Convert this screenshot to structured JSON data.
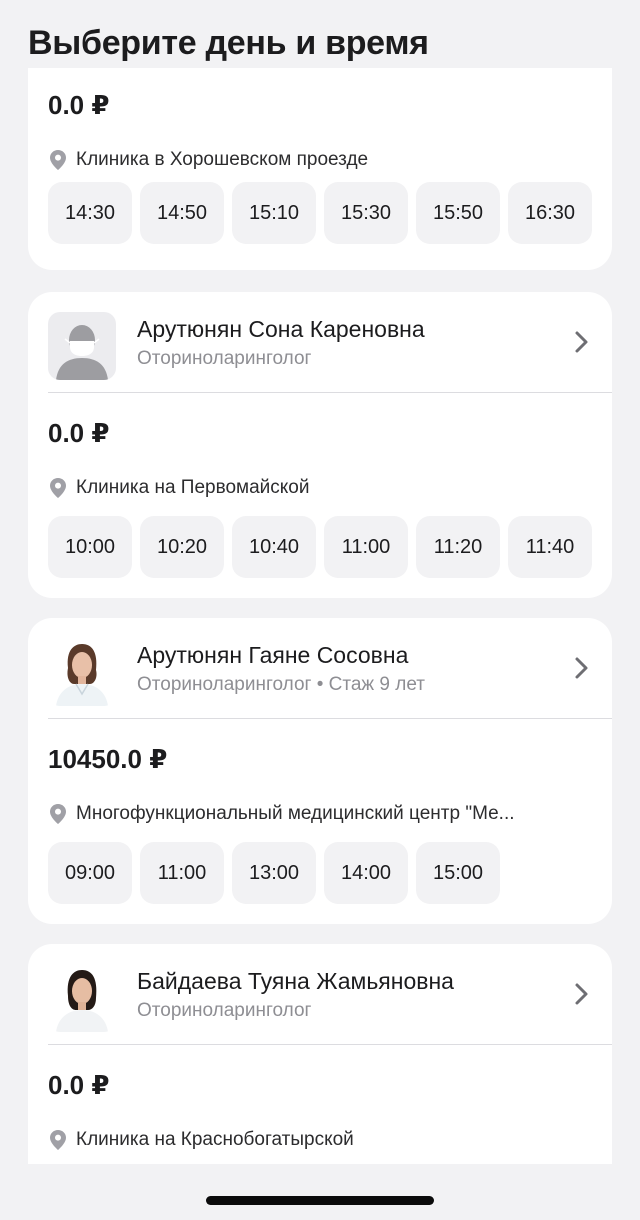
{
  "header": {
    "title": "Выберите день и время"
  },
  "colors": {
    "background": "#f2f2f4",
    "card": "#ffffff",
    "slot": "#f2f2f4",
    "muted_text": "#8e8e93"
  },
  "cards": [
    {
      "price": "0.0 ₽",
      "clinic": "Клиника в Хорошевском проезде",
      "slots": [
        "14:30",
        "14:50",
        "15:10",
        "15:30",
        "15:50",
        "16:30"
      ]
    },
    {
      "doctor_name": "Арутюнян Сона Кареновна",
      "specialty": "Оториноларинголог",
      "avatar": "placeholder-avatar-icon",
      "price": "0.0 ₽",
      "clinic": "Клиника на Первомайской",
      "slots": [
        "10:00",
        "10:20",
        "10:40",
        "11:00",
        "11:20",
        "11:40"
      ]
    },
    {
      "doctor_name": "Арутюнян Гаяне Сосовна",
      "specialty": "Оториноларинголог • Стаж 9 лет",
      "avatar": "doctor-photo",
      "price": "10450.0 ₽",
      "clinic": "Многофункциональный медицинский центр \"Ме...",
      "slots": [
        "09:00",
        "11:00",
        "13:00",
        "14:00",
        "15:00"
      ]
    },
    {
      "doctor_name": "Байдаева Туяна Жамьяновна",
      "specialty": "Оториноларинголог",
      "avatar": "doctor-photo",
      "price": "0.0 ₽",
      "clinic": "Клиника на Краснобогатырской"
    }
  ]
}
